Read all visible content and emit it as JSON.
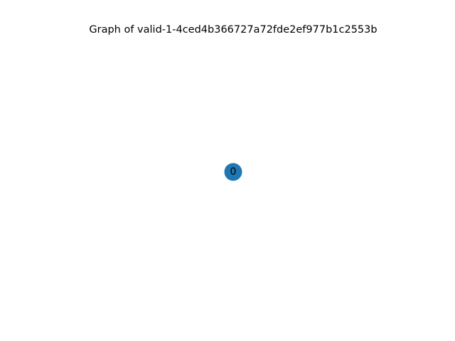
{
  "title": "Graph of valid-1-4ced4b366727a72fde2ef977b1c2553b",
  "graph": {
    "nodes": [
      {
        "id": "0",
        "label": "0"
      }
    ],
    "edges": []
  },
  "colors": {
    "node_fill": "#1f77b4",
    "label_text": "#000000",
    "background": "#ffffff"
  }
}
